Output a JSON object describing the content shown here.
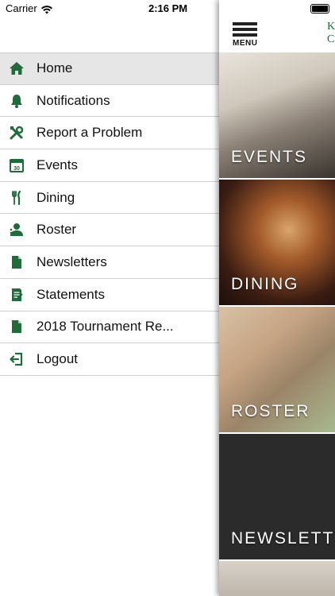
{
  "status_bar": {
    "carrier": "Carrier",
    "time": "2:16 PM"
  },
  "accent_color": "#1f6b3a",
  "drawer": {
    "items": [
      {
        "label": "Home",
        "icon": "home-icon",
        "active": true
      },
      {
        "label": "Notifications",
        "icon": "bell-icon",
        "active": false
      },
      {
        "label": "Report a Problem",
        "icon": "tools-icon",
        "active": false
      },
      {
        "label": "Events",
        "icon": "calendar-icon",
        "active": false
      },
      {
        "label": "Dining",
        "icon": "fork-knife-icon",
        "active": false
      },
      {
        "label": "Roster",
        "icon": "person-icon",
        "active": false
      },
      {
        "label": "Newsletters",
        "icon": "document-icon",
        "active": false
      },
      {
        "label": "Statements",
        "icon": "statement-icon",
        "active": false
      },
      {
        "label": "2018 Tournament Re...",
        "icon": "document-icon",
        "active": false
      },
      {
        "label": "Logout",
        "icon": "logout-icon",
        "active": false
      }
    ]
  },
  "app": {
    "menu_label": "MENU",
    "brand_line1": "K",
    "brand_line2": "C",
    "tiles": [
      {
        "label": "EVENTS"
      },
      {
        "label": "DINING"
      },
      {
        "label": "ROSTER"
      },
      {
        "label": "NEWSLETT"
      }
    ]
  }
}
